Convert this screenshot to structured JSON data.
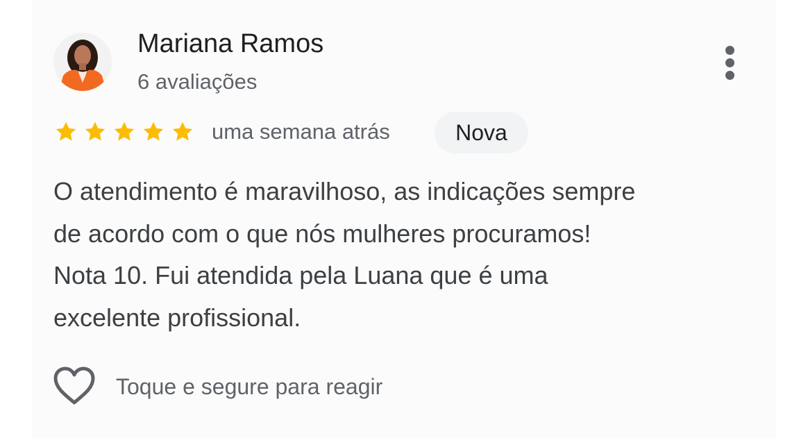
{
  "review": {
    "author_name": "Mariana Ramos",
    "author_reviews": "6 avaliações",
    "rating": 5,
    "rating_max": 5,
    "time": "uma semana atrás",
    "badge": "Nova",
    "text_lines": [
      "O atendimento é maravilhoso, as indicações sempre",
      "de acordo com o que nós mulheres procuramos!",
      "Nota 10. Fui atendida pela Luana que é uma",
      "excelente profissional."
    ],
    "react_hint": "Toque e segure para reagir"
  },
  "icons": {
    "more": "more-vertical-icon",
    "star": "star-icon",
    "heart": "heart-outline-icon"
  },
  "colors": {
    "star": "#fbbc04",
    "text_primary": "#1f1f1f",
    "text_secondary": "#5f6368",
    "body_text": "#3c4043",
    "badge_bg": "#f1f3f4"
  }
}
